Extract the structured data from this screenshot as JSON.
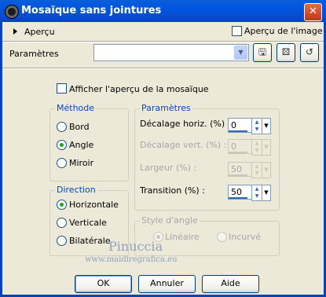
{
  "window": {
    "title": "Mosaïque sans jointures",
    "close_glyph": "✕"
  },
  "preview": {
    "label": "Aperçu",
    "image_preview_label": "Aperçu de l'image",
    "image_preview_checked": false
  },
  "presets": {
    "label": "Paramètres",
    "value": ""
  },
  "mosaic_preview": {
    "label": "Afficher l'aperçu de la mosaïque",
    "checked": false
  },
  "method": {
    "legend": "Méthode",
    "options": [
      "Bord",
      "Angle",
      "Miroir"
    ],
    "selected": "Angle"
  },
  "params": {
    "legend": "Paramètres",
    "fields": [
      {
        "label": "Décalage horiz. (%) :",
        "value": "0",
        "enabled": true
      },
      {
        "label": "Décalage vert. (%) :",
        "value": "0",
        "enabled": false
      },
      {
        "label": "Largeur (%) :",
        "value": "50",
        "enabled": false
      },
      {
        "label": "Transition (%) :",
        "value": "50",
        "enabled": true
      }
    ]
  },
  "direction": {
    "legend": "Direction",
    "options": [
      "Horizontale",
      "Verticale",
      "Bilatérale"
    ],
    "selected": "Horizontale"
  },
  "corner_style": {
    "legend": "Style d'angle",
    "options": [
      "Linéaire",
      "Incurvé"
    ],
    "selected": "Linéaire",
    "enabled": false
  },
  "watermark": {
    "name": "Pinuccia",
    "site": "www.maidiregrafica.eu"
  },
  "buttons": {
    "ok": "OK",
    "cancel": "Annuler",
    "help": "Aide"
  },
  "colors": {
    "titlebar": "#0054e3",
    "group_legend": "#0046d5",
    "window_bg": "#ece9d8"
  }
}
